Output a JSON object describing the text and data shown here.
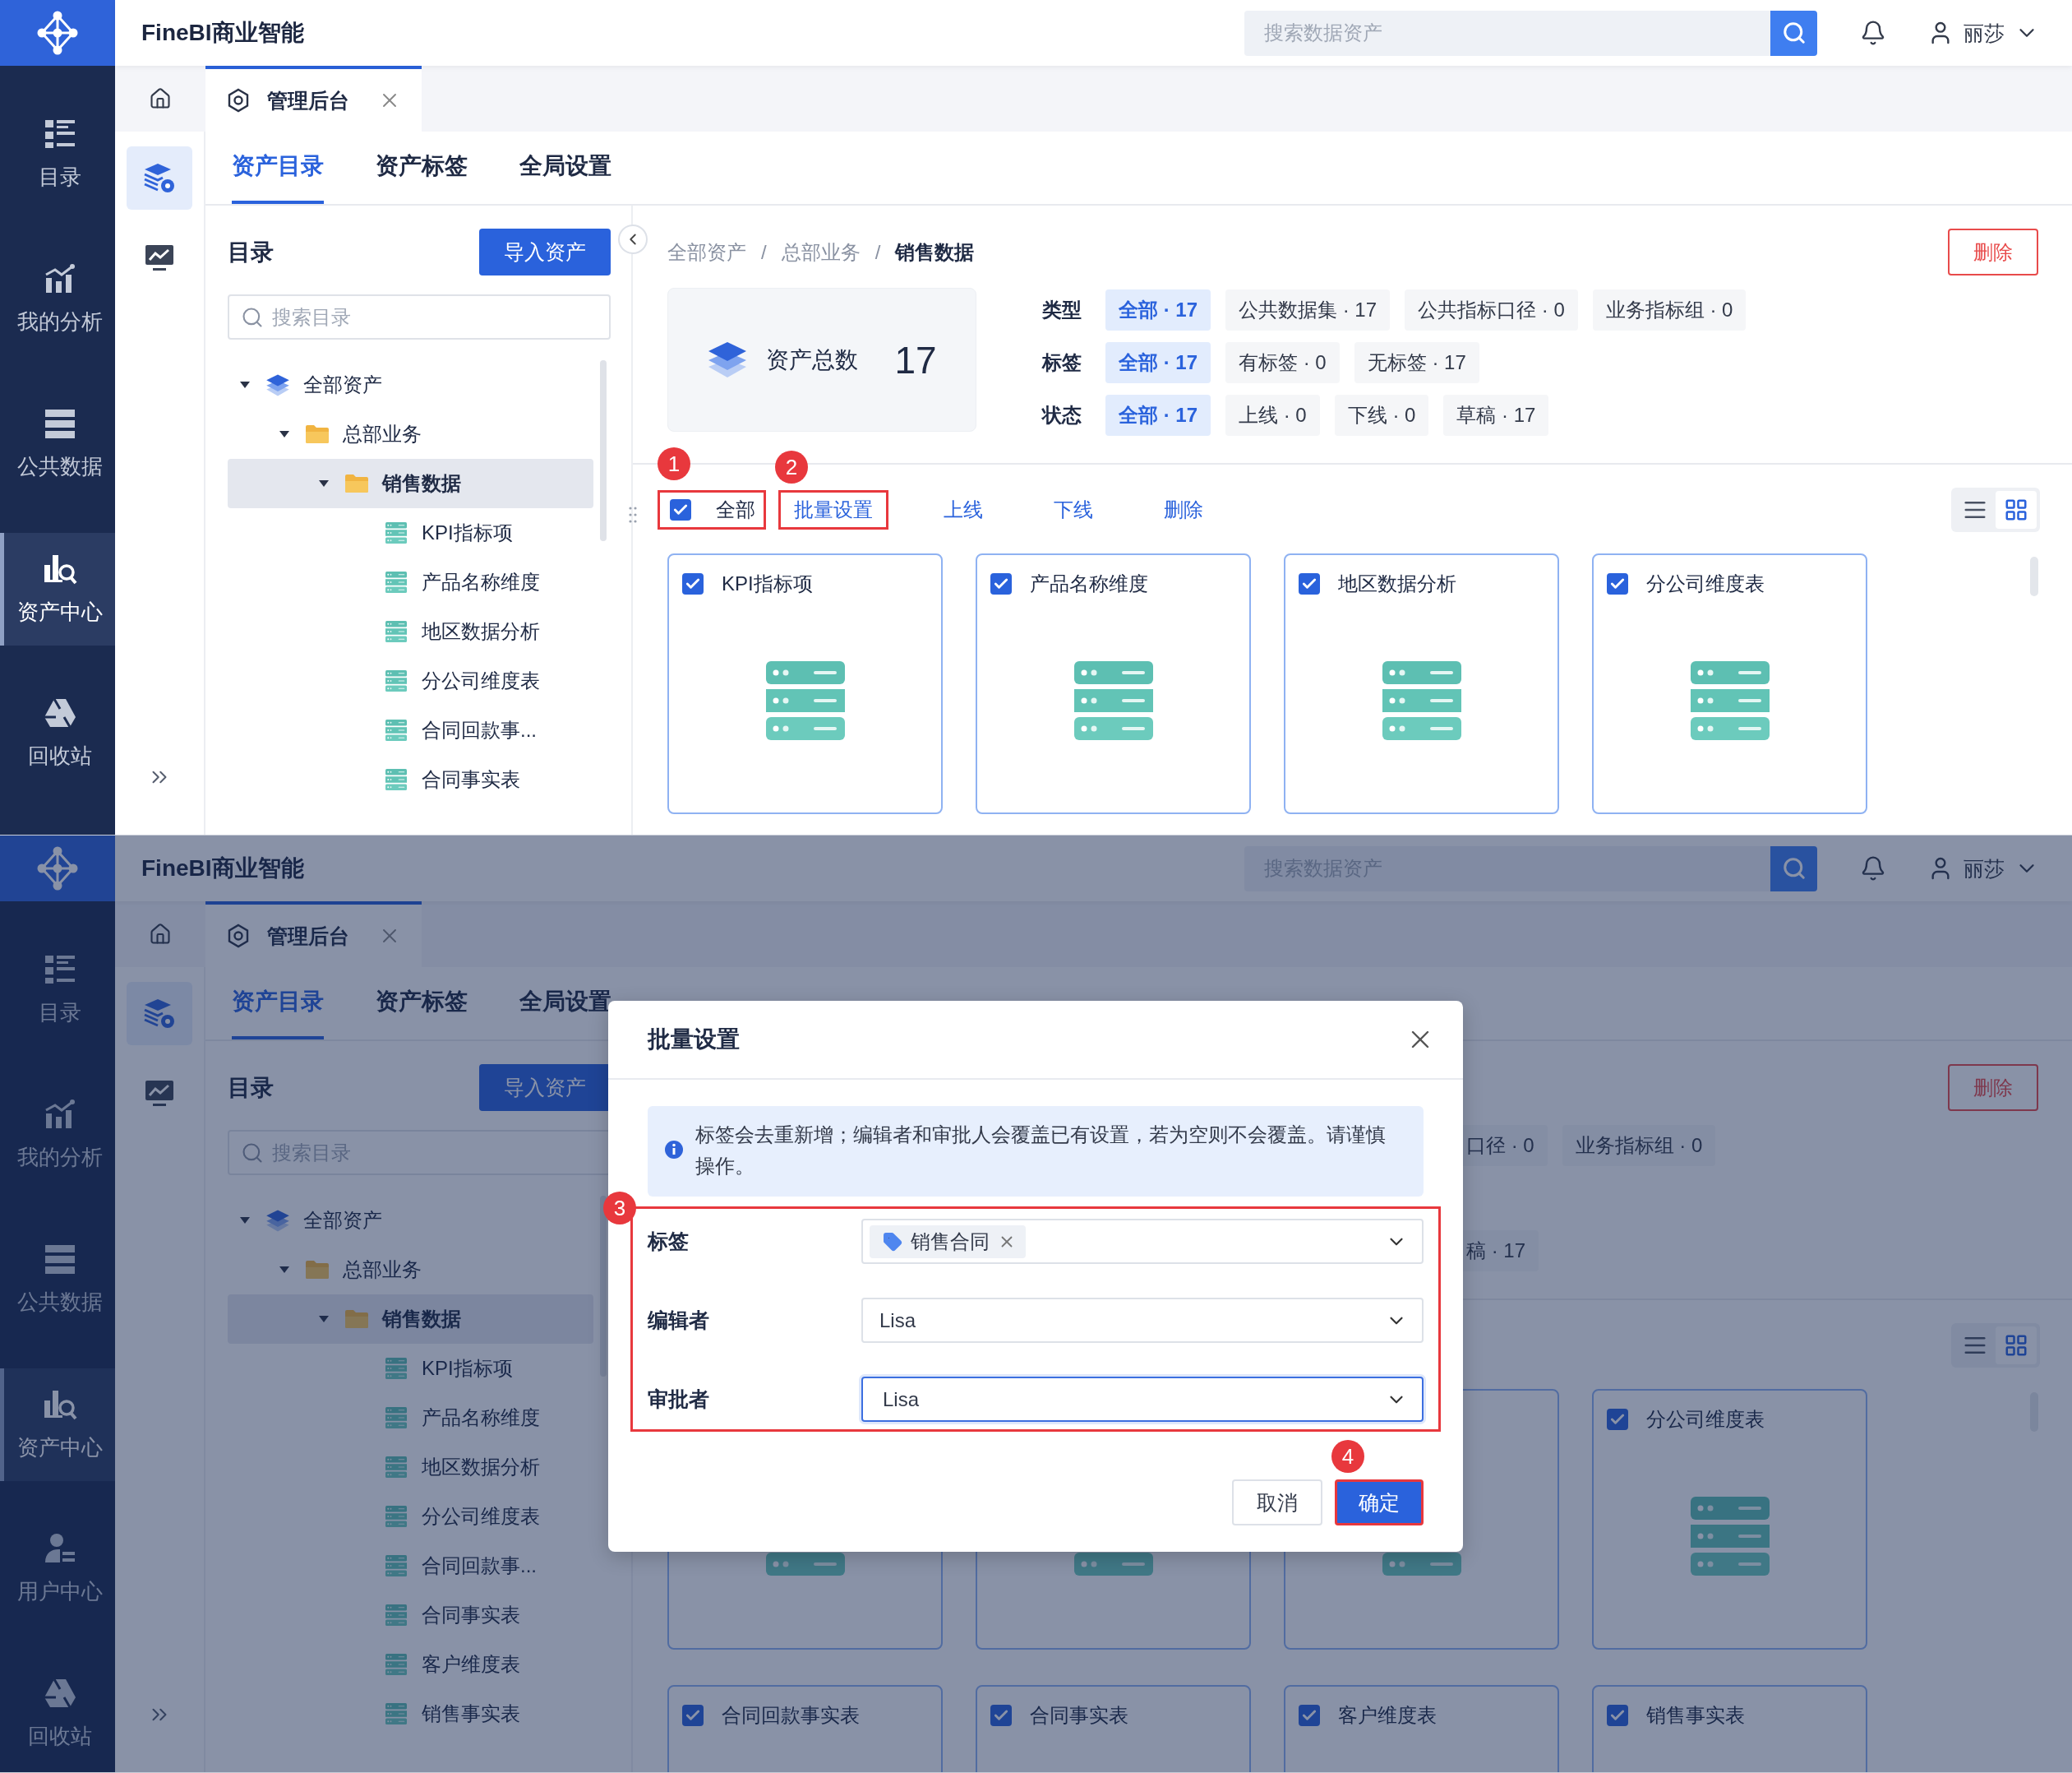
{
  "screens": [
    {
      "kind": "plain",
      "app_title": "FineBI商业智能",
      "search": {
        "placeholder": "搜索数据资产"
      },
      "user": "丽莎",
      "nav": [
        {
          "label": "目录",
          "kind": "catalog",
          "selected": false
        },
        {
          "label": "我的分析",
          "kind": "analysis",
          "selected": false
        },
        {
          "label": "公共数据",
          "kind": "public",
          "selected": false
        },
        {
          "label": "资产中心",
          "kind": "assets",
          "selected": true
        },
        {
          "label": "回收站",
          "kind": "recycle",
          "selected": false
        }
      ],
      "page_tab": {
        "label": "管理后台"
      },
      "tools": [
        {
          "kind": "assets",
          "selected": true
        },
        {
          "kind": "monitor",
          "selected": false
        }
      ],
      "tabs": [
        {
          "label": "资产目录",
          "selected": true
        },
        {
          "label": "资产标签",
          "selected": false
        },
        {
          "label": "全局设置",
          "selected": false
        }
      ],
      "tree": {
        "title": "目录",
        "import_button": "导入资产",
        "search_placeholder": "搜索目录",
        "items": [
          {
            "label": "全部资产",
            "kind": "root",
            "expanded": true,
            "selected": false,
            "children": [
              {
                "label": "总部业务",
                "kind": "folder",
                "expanded": true,
                "selected": false,
                "children": [
                  {
                    "label": "销售数据",
                    "kind": "folder",
                    "expanded": true,
                    "selected": true,
                    "children": [
                      {
                        "label": "KPI指标项",
                        "kind": "dataset",
                        "selected": false
                      },
                      {
                        "label": "产品名称维度",
                        "kind": "dataset",
                        "selected": false
                      },
                      {
                        "label": "地区数据分析",
                        "kind": "dataset",
                        "selected": false
                      },
                      {
                        "label": "分公司维度表",
                        "kind": "dataset",
                        "selected": false
                      },
                      {
                        "label": "合同回款事...",
                        "kind": "dataset",
                        "selected": false
                      },
                      {
                        "label": "合同事实表",
                        "kind": "dataset",
                        "selected": false
                      }
                    ]
                  }
                ]
              }
            ]
          }
        ]
      },
      "main": {
        "breadcrumb": [
          {
            "label": "全部资产",
            "kind": "link"
          },
          {
            "label": "/",
            "kind": "separator"
          },
          {
            "label": "总部业务",
            "kind": "link"
          },
          {
            "label": "/",
            "kind": "separator"
          },
          {
            "label": "销售数据",
            "kind": "current"
          }
        ],
        "delete_button": "删除",
        "stats": {
          "label": "资产总数",
          "value": "17"
        },
        "filters": [
          {
            "label": "类型",
            "chips": [
              {
                "label": "全部 · 17",
                "selected": true
              },
              {
                "label": "公共数据集 · 17",
                "selected": false
              },
              {
                "label": "公共指标口径 · 0",
                "selected": false
              },
              {
                "label": "业务指标组 · 0",
                "selected": false
              }
            ]
          },
          {
            "label": "标签",
            "chips": [
              {
                "label": "全部 · 17",
                "selected": true
              },
              {
                "label": "有标签 · 0",
                "selected": false
              },
              {
                "label": "无标签 · 17",
                "selected": false
              }
            ]
          },
          {
            "label": "状态",
            "chips": [
              {
                "label": "全部 · 17",
                "selected": true
              },
              {
                "label": "上线 · 0",
                "selected": false
              },
              {
                "label": "下线 · 0",
                "selected": false
              },
              {
                "label": "草稿 · 17",
                "selected": false
              }
            ]
          }
        ],
        "actions": {
          "select_all": {
            "label": "全部",
            "checked": true,
            "callout": "1"
          },
          "buttons": [
            {
              "label": "批量设置",
              "callout": "2"
            },
            {
              "label": "上线"
            },
            {
              "label": "下线"
            },
            {
              "label": "删除"
            }
          ]
        },
        "view_toggle": [
          {
            "kind": "list",
            "selected": false
          },
          {
            "kind": "grid",
            "selected": true
          }
        ],
        "cards": [
          {
            "title": "KPI指标项",
            "checked": true,
            "kind": "dataset"
          },
          {
            "title": "产品名称维度",
            "checked": true,
            "kind": "dataset"
          },
          {
            "title": "地区数据分析",
            "checked": true,
            "kind": "dataset"
          },
          {
            "title": "分公司维度表",
            "checked": true,
            "kind": "dataset"
          }
        ]
      }
    },
    {
      "kind": "dialog",
      "app_title": "FineBI商业智能",
      "search": {
        "placeholder": "搜索数据资产"
      },
      "user": "丽莎",
      "nav": [
        {
          "label": "目录",
          "kind": "catalog",
          "selected": false
        },
        {
          "label": "我的分析",
          "kind": "analysis",
          "selected": false
        },
        {
          "label": "公共数据",
          "kind": "public",
          "selected": false
        },
        {
          "label": "资产中心",
          "kind": "assets",
          "selected": true
        },
        {
          "label": "用户中心",
          "kind": "users",
          "selected": false
        },
        {
          "label": "回收站",
          "kind": "recycle",
          "selected": false
        }
      ],
      "page_tab": {
        "label": "管理后台"
      },
      "tools": [
        {
          "kind": "assets",
          "selected": true
        },
        {
          "kind": "monitor",
          "selected": false
        }
      ],
      "tabs": [
        {
          "label": "资产目录",
          "selected": true
        },
        {
          "label": "资产标签",
          "selected": false
        },
        {
          "label": "全局设置",
          "selected": false
        }
      ],
      "tree": {
        "title": "目录",
        "import_button": "导入资产",
        "search_placeholder": "搜索目录",
        "items": [
          {
            "label": "全部资产",
            "kind": "root",
            "expanded": true,
            "selected": false,
            "children": [
              {
                "label": "总部业务",
                "kind": "folder",
                "expanded": true,
                "selected": false,
                "children": [
                  {
                    "label": "销售数据",
                    "kind": "folder",
                    "expanded": true,
                    "selected": true,
                    "children": [
                      {
                        "label": "KPI指标项",
                        "kind": "dataset",
                        "selected": false
                      },
                      {
                        "label": "产品名称维度",
                        "kind": "dataset",
                        "selected": false
                      },
                      {
                        "label": "地区数据分析",
                        "kind": "dataset",
                        "selected": false
                      },
                      {
                        "label": "分公司维度表",
                        "kind": "dataset",
                        "selected": false
                      },
                      {
                        "label": "合同回款事...",
                        "kind": "dataset",
                        "selected": false
                      },
                      {
                        "label": "合同事实表",
                        "kind": "dataset",
                        "selected": false
                      },
                      {
                        "label": "客户维度表",
                        "kind": "dataset",
                        "selected": false
                      },
                      {
                        "label": "销售事实表",
                        "kind": "dataset",
                        "selected": false
                      }
                    ]
                  }
                ]
              }
            ]
          }
        ]
      },
      "main": {
        "delete_button": "删除",
        "filters": [
          {
            "chips": [
              {
                "label": "口径 · 0",
                "kind": "cut",
                "selected": false
              },
              {
                "label": "业务指标组 · 0",
                "selected": false
              }
            ]
          },
          {
            "chips": [
              {
                "label": "稿 · 17",
                "kind": "cut",
                "selected": false
              }
            ]
          }
        ],
        "view_toggle": [
          {
            "kind": "list",
            "selected": false
          },
          {
            "kind": "grid",
            "selected": true
          }
        ],
        "cards": [
          {
            "kind": "dataset"
          },
          {
            "kind": "dataset"
          },
          {
            "kind": "dataset"
          },
          {
            "title": "分公司维度表",
            "checked": true,
            "kind": "dataset"
          },
          {
            "title": "合同回款事实表",
            "checked": true
          },
          {
            "title": "合同事实表",
            "checked": true
          },
          {
            "title": "客户维度表",
            "checked": true
          },
          {
            "title": "销售事实表",
            "checked": true
          }
        ]
      },
      "dialog": {
        "title": "批量设置",
        "notice": "标签会去重新增；编辑者和审批人会覆盖已有设置，若为空则不会覆盖。请谨慎操作。",
        "callout": "3",
        "fields": [
          {
            "label": "标签",
            "kind": "tags",
            "tags": [
              {
                "label": "销售合同"
              }
            ],
            "focused": false
          },
          {
            "label": "编辑者",
            "kind": "select",
            "value": "Lisa",
            "focused": false
          },
          {
            "label": "审批者",
            "kind": "select",
            "value": "Lisa",
            "focused": true
          }
        ],
        "buttons": [
          {
            "label": "取消",
            "kind": "secondary"
          },
          {
            "label": "确定",
            "kind": "primary",
            "callout": "4"
          }
        ]
      }
    }
  ]
}
